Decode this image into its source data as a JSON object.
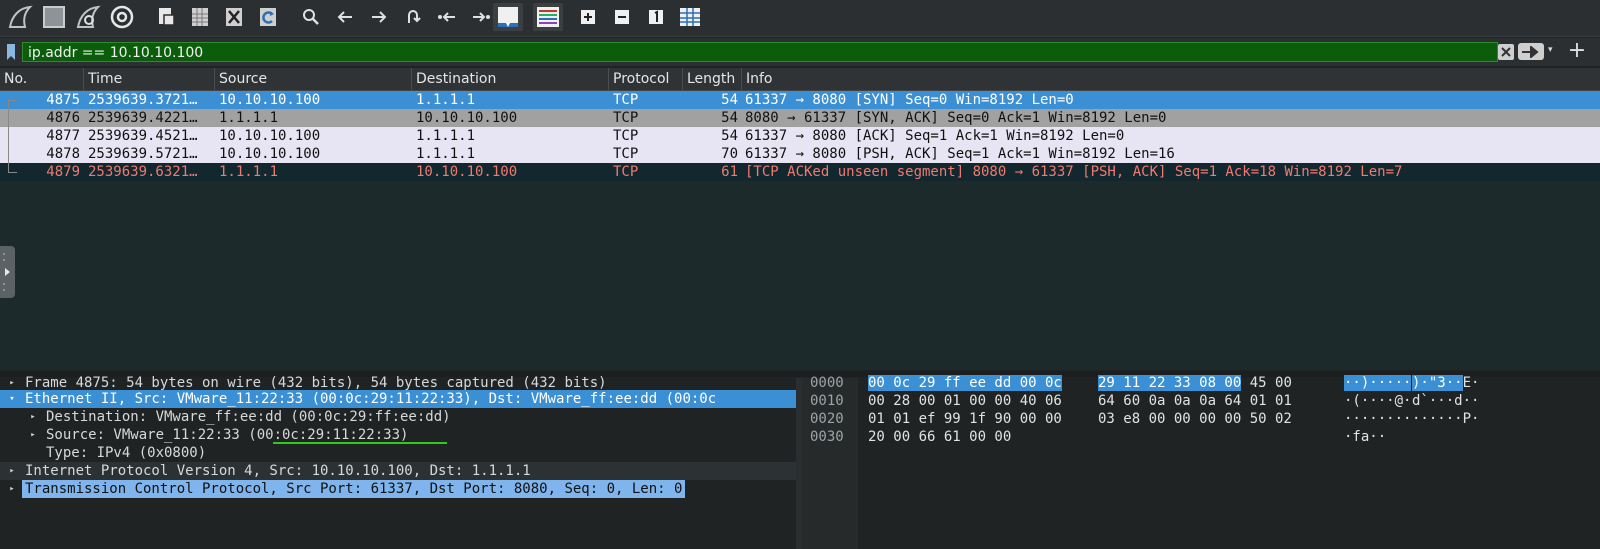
{
  "toolbar": {
    "icons": [
      "shark-fin-icon",
      "stop-icon",
      "restart-icon",
      "options-gear-icon",
      "open-file-icon",
      "save-file-icon",
      "close-file-icon",
      "reload-icon",
      "search-icon",
      "back-arrow-icon",
      "forward-arrow-icon",
      "go-to-packet-icon",
      "first-packet-icon",
      "last-packet-icon",
      "autoscroll-icon",
      "colorize-icon",
      "zoom-in-icon",
      "zoom-out-icon",
      "normal-size-icon",
      "resize-columns-icon"
    ]
  },
  "filter": {
    "value": "ip.addr == 10.10.10.100",
    "recent_glyph": "▾",
    "add_glyph": "+"
  },
  "packet_list": {
    "columns": [
      "No.",
      "Time",
      "Source",
      "Destination",
      "Protocol",
      "Length",
      "Info"
    ],
    "rows": [
      {
        "no": "4875",
        "time": "2539639.3721…",
        "src": "10.10.10.100",
        "dst": "1.1.1.1",
        "proto": "TCP",
        "len": "54",
        "info": "61337 → 8080 [SYN] Seq=0 Win=8192 Len=0",
        "bg": "#3b8fd4",
        "fg": "#ffffff"
      },
      {
        "no": "4876",
        "time": "2539639.4221…",
        "src": "1.1.1.1",
        "dst": "10.10.10.100",
        "proto": "TCP",
        "len": "54",
        "info": "8080 → 61337 [SYN, ACK] Seq=0 Ack=1 Win=8192 Len=0",
        "bg": "#a1a1a1",
        "fg": "#111111"
      },
      {
        "no": "4877",
        "time": "2539639.4521…",
        "src": "10.10.10.100",
        "dst": "1.1.1.1",
        "proto": "TCP",
        "len": "54",
        "info": "61337 → 8080 [ACK] Seq=1 Ack=1 Win=8192 Len=0",
        "bg": "#e7e5f4",
        "fg": "#111111"
      },
      {
        "no": "4878",
        "time": "2539639.5721…",
        "src": "10.10.10.100",
        "dst": "1.1.1.1",
        "proto": "TCP",
        "len": "70",
        "info": "61337 → 8080 [PSH, ACK] Seq=1 Ack=1 Win=8192 Len=16",
        "bg": "#e7e5f4",
        "fg": "#111111"
      },
      {
        "no": "4879",
        "time": "2539639.6321…",
        "src": "1.1.1.1",
        "dst": "10.10.10.100",
        "proto": "TCP",
        "len": "61",
        "info": "[TCP ACKed unseen segment] 8080 → 61337 [PSH, ACK] Seq=1 Ack=18 Win=8192 Len=7",
        "bg": "#12272e",
        "fg": "#f07a70"
      }
    ]
  },
  "details": {
    "rows": [
      {
        "indent": 0,
        "arrow": "▸",
        "text": "Frame 4875: 54 bytes on wire (432 bits), 54 bytes captured (432 bits)",
        "state": "normal"
      },
      {
        "indent": 0,
        "arrow": "▾",
        "text": "Ethernet II, Src: VMware_11:22:33 (00:0c:29:11:22:33), Dst: VMware_ff:ee:dd (00:0c",
        "state": "selected"
      },
      {
        "indent": 1,
        "arrow": "▸",
        "text": "Destination: VMware_ff:ee:dd (00:0c:29:ff:ee:dd)",
        "state": "normal"
      },
      {
        "indent": 1,
        "arrow": "▸",
        "text": "Source: VMware_11:22:33 (00:0c:29:11:22:33)",
        "state": "underline"
      },
      {
        "indent": 1,
        "arrow": "",
        "text": "Type: IPv4 (0x0800)",
        "state": "normal"
      },
      {
        "indent": 0,
        "arrow": "▸",
        "text": "Internet Protocol Version 4, Src: 10.10.10.100, Dst: 1.1.1.1",
        "state": "normal"
      },
      {
        "indent": 0,
        "arrow": "▸",
        "text": "Transmission Control Protocol, Src Port: 61337, Dst Port: 8080, Seq: 0, Len: 0",
        "state": "hover"
      }
    ]
  },
  "bytes": {
    "rows": [
      {
        "offset": "0000",
        "hex1_hl": "00 0c 29 ff ee dd 00 0c",
        "hex1": "",
        "hex2_hl": "29 11 22 33 08 00",
        "hex2": " 45 00",
        "ascii1_hl": "··)·····",
        "ascii1": "",
        "ascii2_hl": " )·\"3··",
        "ascii2": "E·"
      },
      {
        "offset": "0010",
        "hex1_hl": "",
        "hex1": "00 28 00 01 00 00 40 06",
        "hex2_hl": "",
        "hex2": "64 60 0a 0a 0a 64 01 01",
        "ascii1_hl": "",
        "ascii1": "·(····@·",
        "ascii2_hl": "",
        "ascii2": "d`···d··"
      },
      {
        "offset": "0020",
        "hex1_hl": "",
        "hex1": "01 01 ef 99 1f 90 00 00",
        "hex2_hl": "",
        "hex2": "03 e8 00 00 00 00 50 02",
        "ascii1_hl": "",
        "ascii1": "········",
        "ascii2_hl": "",
        "ascii2": "······P·"
      },
      {
        "offset": "0030",
        "hex1_hl": "",
        "hex1": "20 00 66 61 00 00",
        "hex2_hl": "",
        "hex2": "",
        "ascii1_hl": "",
        "ascii1": " ·fa··",
        "ascii2_hl": "",
        "ascii2": ""
      }
    ]
  }
}
